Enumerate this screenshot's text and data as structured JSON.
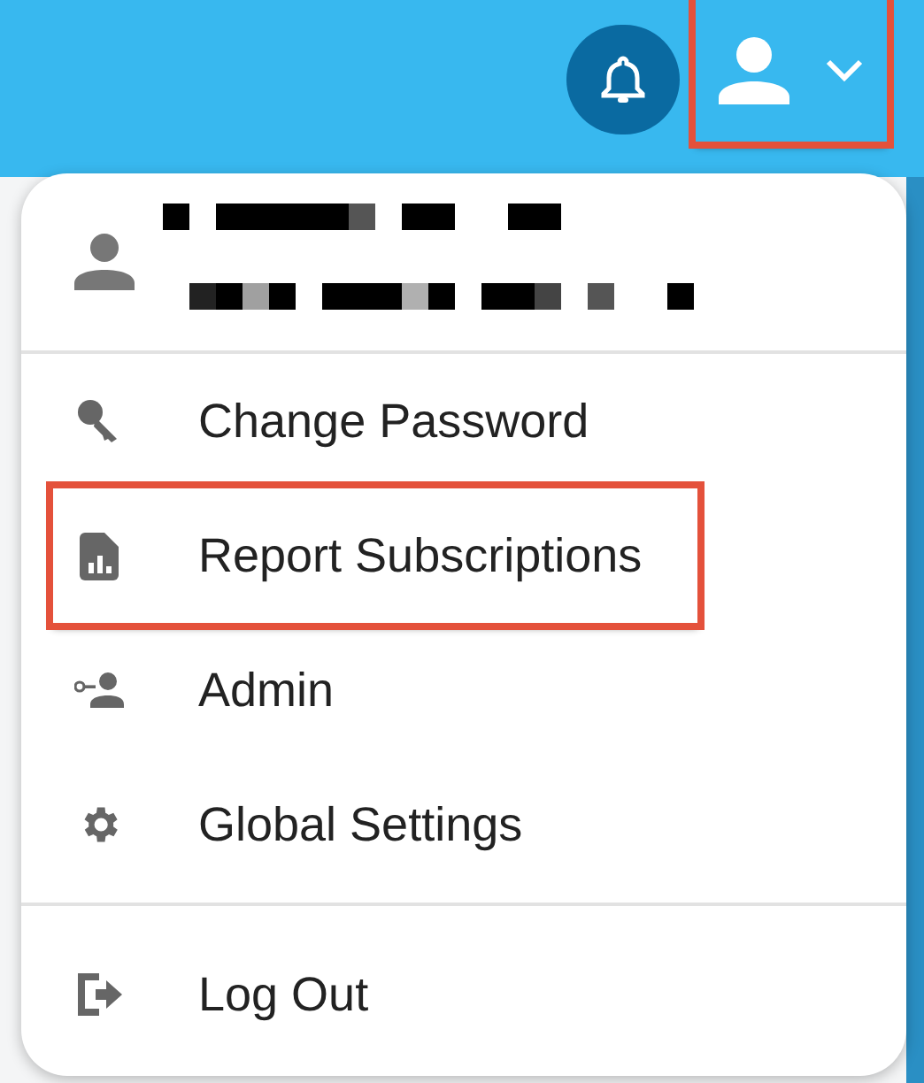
{
  "top_bar": {
    "notifications_button": {
      "highlighted": false
    },
    "user_menu_button": {
      "highlighted": true
    }
  },
  "menu": {
    "groups": [
      {
        "items": [
          {
            "label": "Change Password",
            "kind": "key",
            "highlighted": false
          },
          {
            "label": "Report Subscriptions",
            "kind": "report",
            "highlighted": true
          },
          {
            "label": "Admin",
            "kind": "admin",
            "highlighted": false
          },
          {
            "label": "Global Settings",
            "kind": "gear",
            "highlighted": false
          }
        ]
      },
      {
        "items": [
          {
            "label": "Log Out",
            "kind": "logout",
            "highlighted": false
          }
        ]
      }
    ]
  }
}
